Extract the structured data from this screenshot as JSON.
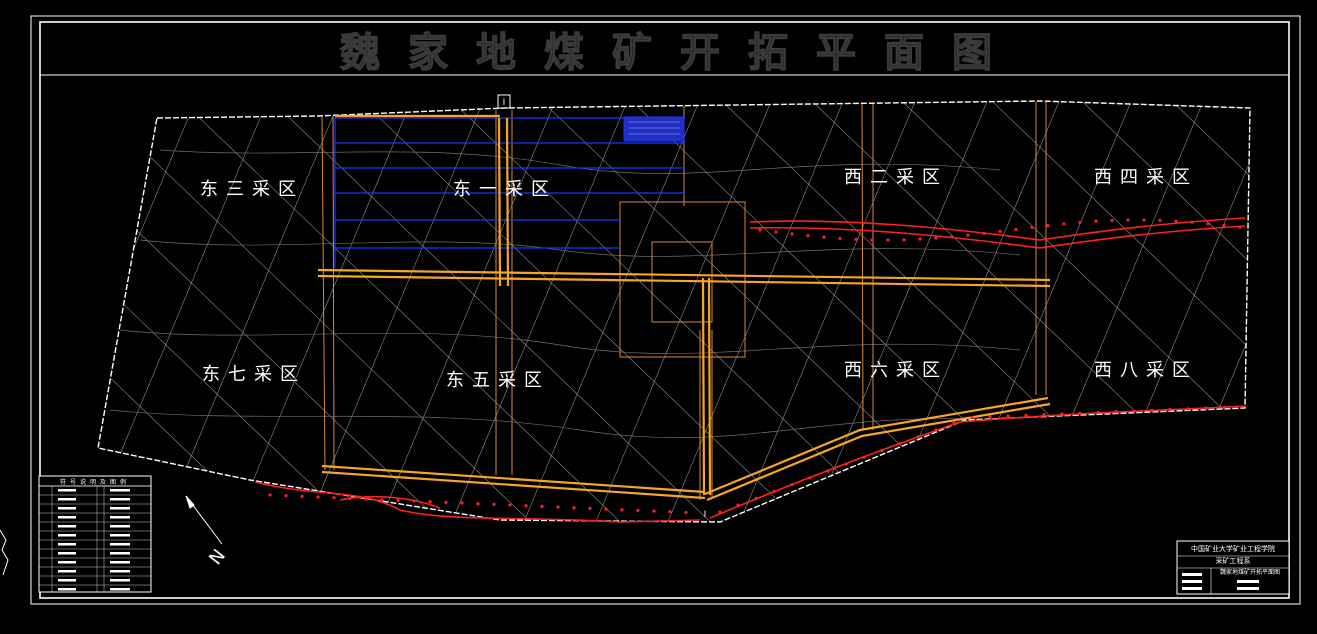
{
  "drawing": {
    "title": "魏家地煤矿开拓平面图"
  },
  "zones": [
    {
      "id": "east-3",
      "label": "东三采区"
    },
    {
      "id": "east-1",
      "label": "东一采区"
    },
    {
      "id": "west-2",
      "label": "西二采区"
    },
    {
      "id": "west-4",
      "label": "西四采区"
    },
    {
      "id": "east-7",
      "label": "东七采区"
    },
    {
      "id": "east-5",
      "label": "东五采区"
    },
    {
      "id": "west-6",
      "label": "西六采区"
    },
    {
      "id": "west-8",
      "label": "西八采区"
    }
  ],
  "north_arrow": {
    "label": "N"
  },
  "shaft_markers": [
    {
      "label": "I"
    },
    {
      "label": "I"
    }
  ],
  "title_block": {
    "institution": "中国矿业大学矿业工程学院",
    "department": "采矿工程系",
    "drawing_name": "魏家地煤矿开拓平面图"
  },
  "legend_table": {
    "header": "符号说明及图例"
  },
  "colors": {
    "background": "#000000",
    "frame": "#ffffff",
    "title": "#2a2a2a",
    "boundary": "#ffffff",
    "grid": "#9a9a9a",
    "roadway": "#f5a623",
    "panel_line": "#2233ff",
    "fault": "#ff2020",
    "block_outline": "#d88a3a"
  }
}
